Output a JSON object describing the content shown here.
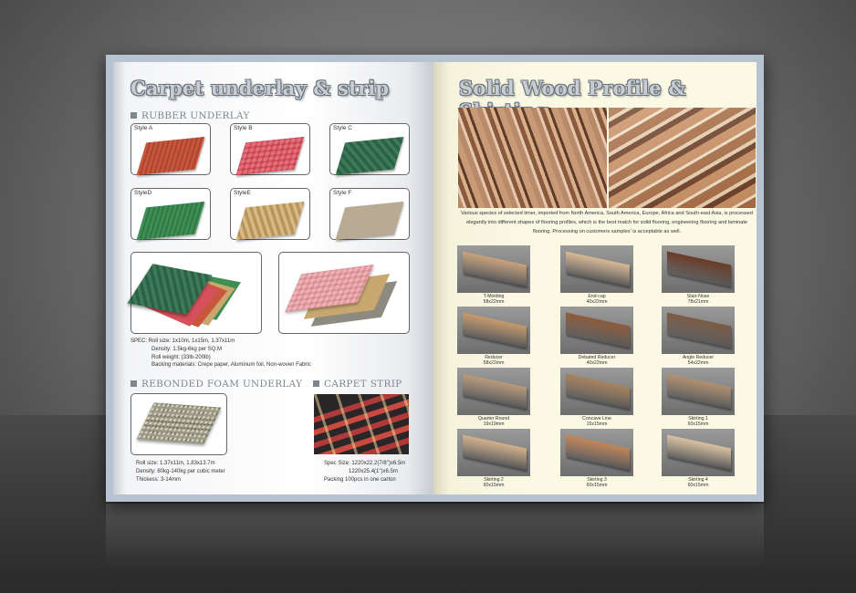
{
  "left_page": {
    "title": "Carpet underlay & strip",
    "rubber": {
      "heading": "RUBBER UNDERLAY",
      "styles": [
        {
          "label": "Style A",
          "color": "#c8563b"
        },
        {
          "label": "Style B",
          "color": "#d4505a"
        },
        {
          "label": "Style C",
          "color": "#3d7a58"
        },
        {
          "label": "StyleD",
          "color": "#3f8f55"
        },
        {
          "label": "StyleE",
          "color": "#c9a870"
        },
        {
          "label": "Style F",
          "color": "#b9ab93"
        }
      ],
      "spec": [
        "SPEC: Roll size: 1x10m, 1x15m, 1.37x11m",
        "Density: 1.5kg-6kg per SQ.M",
        "Roll weight: (33lb-200lb)",
        "Backing materials: Crepe paper, Aluminum foil, Non-woven Fabric"
      ]
    },
    "foam": {
      "heading": "REBONDED FOAM UNDERLAY",
      "spec": [
        "Roll size: 1.37x11m, 1.83x13.7m",
        "Density: 80kg-140kg  per cubic meter",
        "Thickess: 3-14mm"
      ]
    },
    "strip": {
      "heading": "CARPET STRIP",
      "spec": [
        "Spec Size: 1220x22.2(7/8\")x6.5m",
        "1220x25.4(1\")x6.5m",
        "Packing  100pcs in one carton"
      ]
    }
  },
  "right_page": {
    "title": "Solid Wood Profile & Skirting",
    "description": "Various species of selected timer, imported from North America, South America, Europe, Africa and South-east Asia, is processed elegantly into different shapes of flooring profiles, which is the best match for solid flooring, engineering flooring and laminate flooring. Processing on customers samples' is acceptable as well.",
    "profiles": [
      {
        "name": "T-Molding",
        "size": "58x22mm"
      },
      {
        "name": "End-cap",
        "size": "40x22mm"
      },
      {
        "name": "Stair-Nose",
        "size": "78x21mm"
      },
      {
        "name": "Reducer",
        "size": "58x22mm"
      },
      {
        "name": "Debated Reducer",
        "size": "40x22mm"
      },
      {
        "name": "Angle Reducer",
        "size": "54x22mm"
      },
      {
        "name": "Quarter Round",
        "size": "19x19mm"
      },
      {
        "name": "Concave Line",
        "size": "15x15mm"
      },
      {
        "name": "Skirting 1",
        "size": "60x15mm"
      },
      {
        "name": "Skirting 2",
        "size": "60x15mm"
      },
      {
        "name": "Skirting 3",
        "size": "60x15mm"
      },
      {
        "name": "Skirting 4",
        "size": "60x15mm"
      }
    ]
  }
}
